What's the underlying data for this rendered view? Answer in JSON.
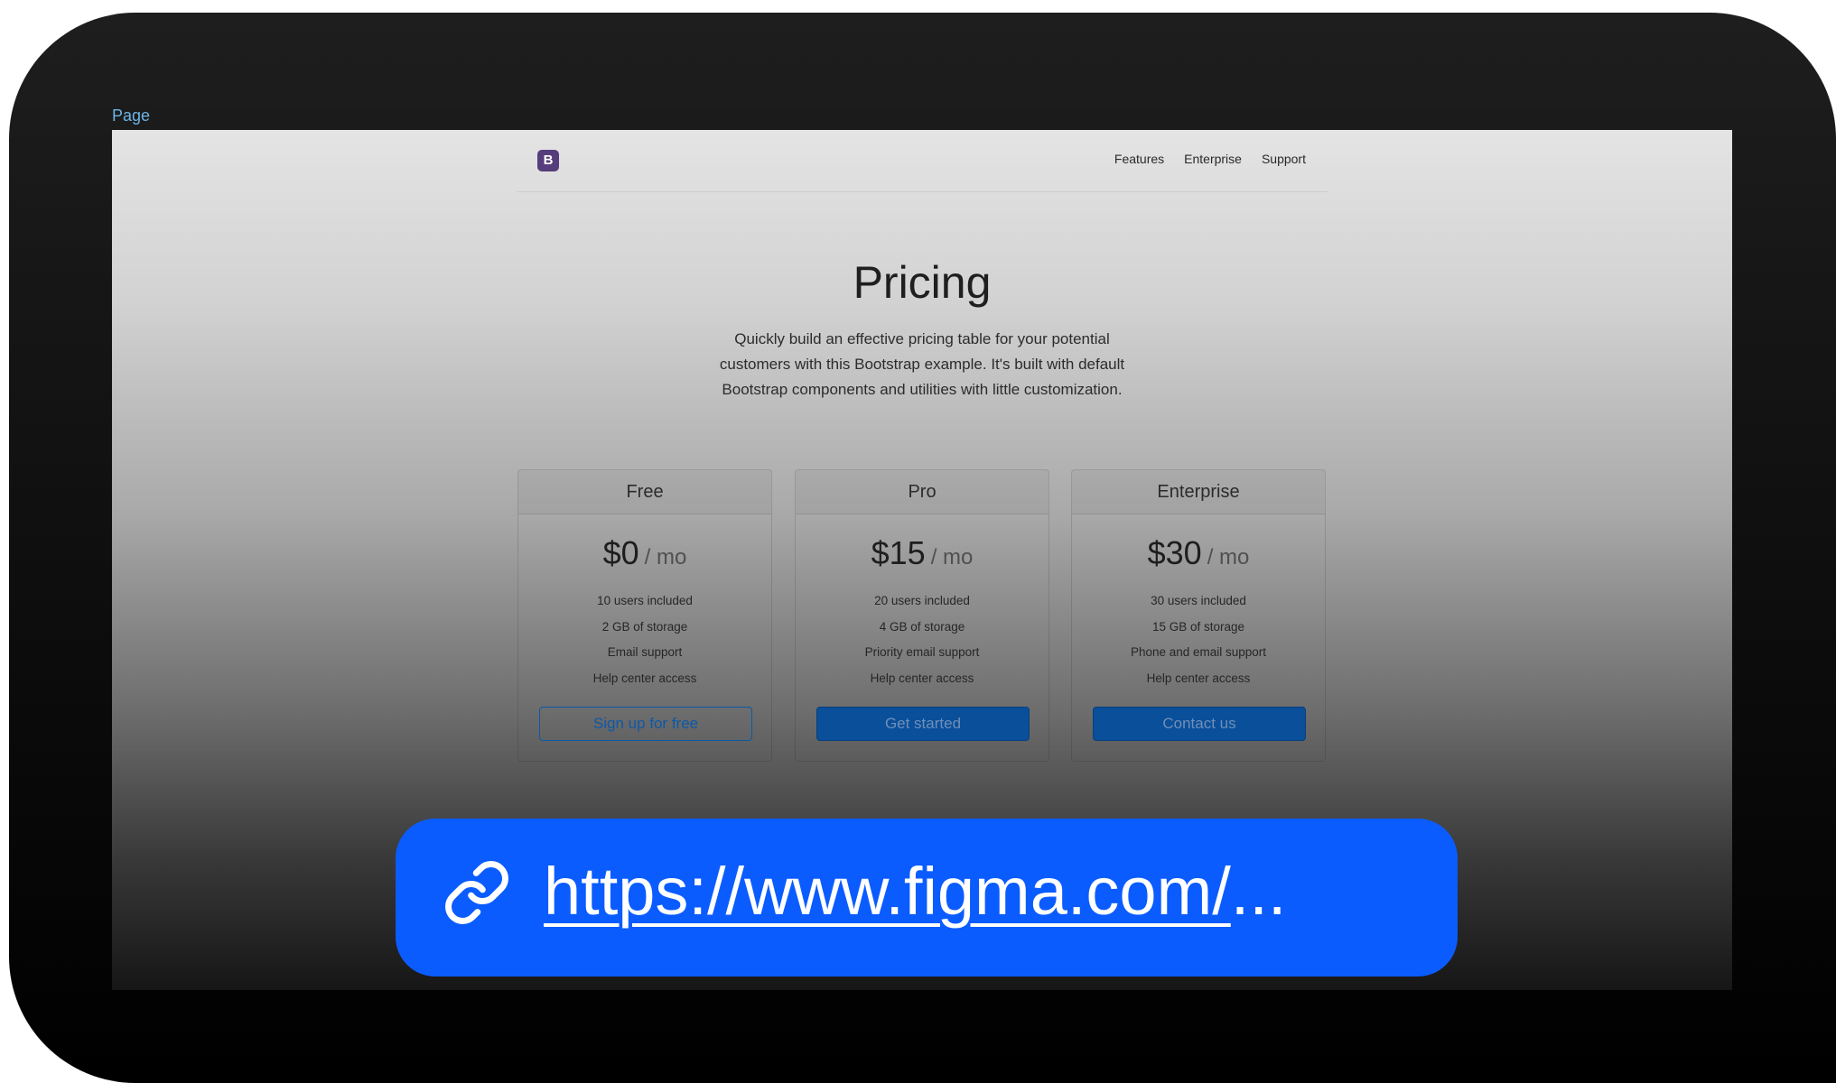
{
  "canvas": {
    "frame_label": "Page"
  },
  "nav": {
    "brand": "B",
    "links": [
      "Features",
      "Enterprise",
      "Support"
    ]
  },
  "hero": {
    "title": "Pricing",
    "lead_lines": [
      "Quickly build an effective pricing table for your potential",
      "customers with this Bootstrap example. It's built with default",
      "Bootstrap components and utilities with little customization."
    ]
  },
  "plans": [
    {
      "name": "Free",
      "price": "$0",
      "period": "/ mo",
      "features": [
        "10 users included",
        "2 GB of storage",
        "Email support",
        "Help center access"
      ],
      "cta": "Sign up for free"
    },
    {
      "name": "Pro",
      "price": "$15",
      "period": "/ mo",
      "features": [
        "20 users included",
        "4 GB of storage",
        "Priority email support",
        "Help center access"
      ],
      "cta": "Get started"
    },
    {
      "name": "Enterprise",
      "price": "$30",
      "period": "/ mo",
      "features": [
        "30 users included",
        "15 GB of storage",
        "Phone and email support",
        "Help center access"
      ],
      "cta": "Contact us"
    }
  ],
  "link_banner": {
    "url_text": "https://www.figma.com/",
    "ellipsis": "...",
    "icon": "link-icon"
  },
  "colors": {
    "brand_purple": "#563d7c",
    "primary_blue": "#0d59a6",
    "banner_blue": "#0a5cff",
    "frame_label": "#6db3e6"
  }
}
